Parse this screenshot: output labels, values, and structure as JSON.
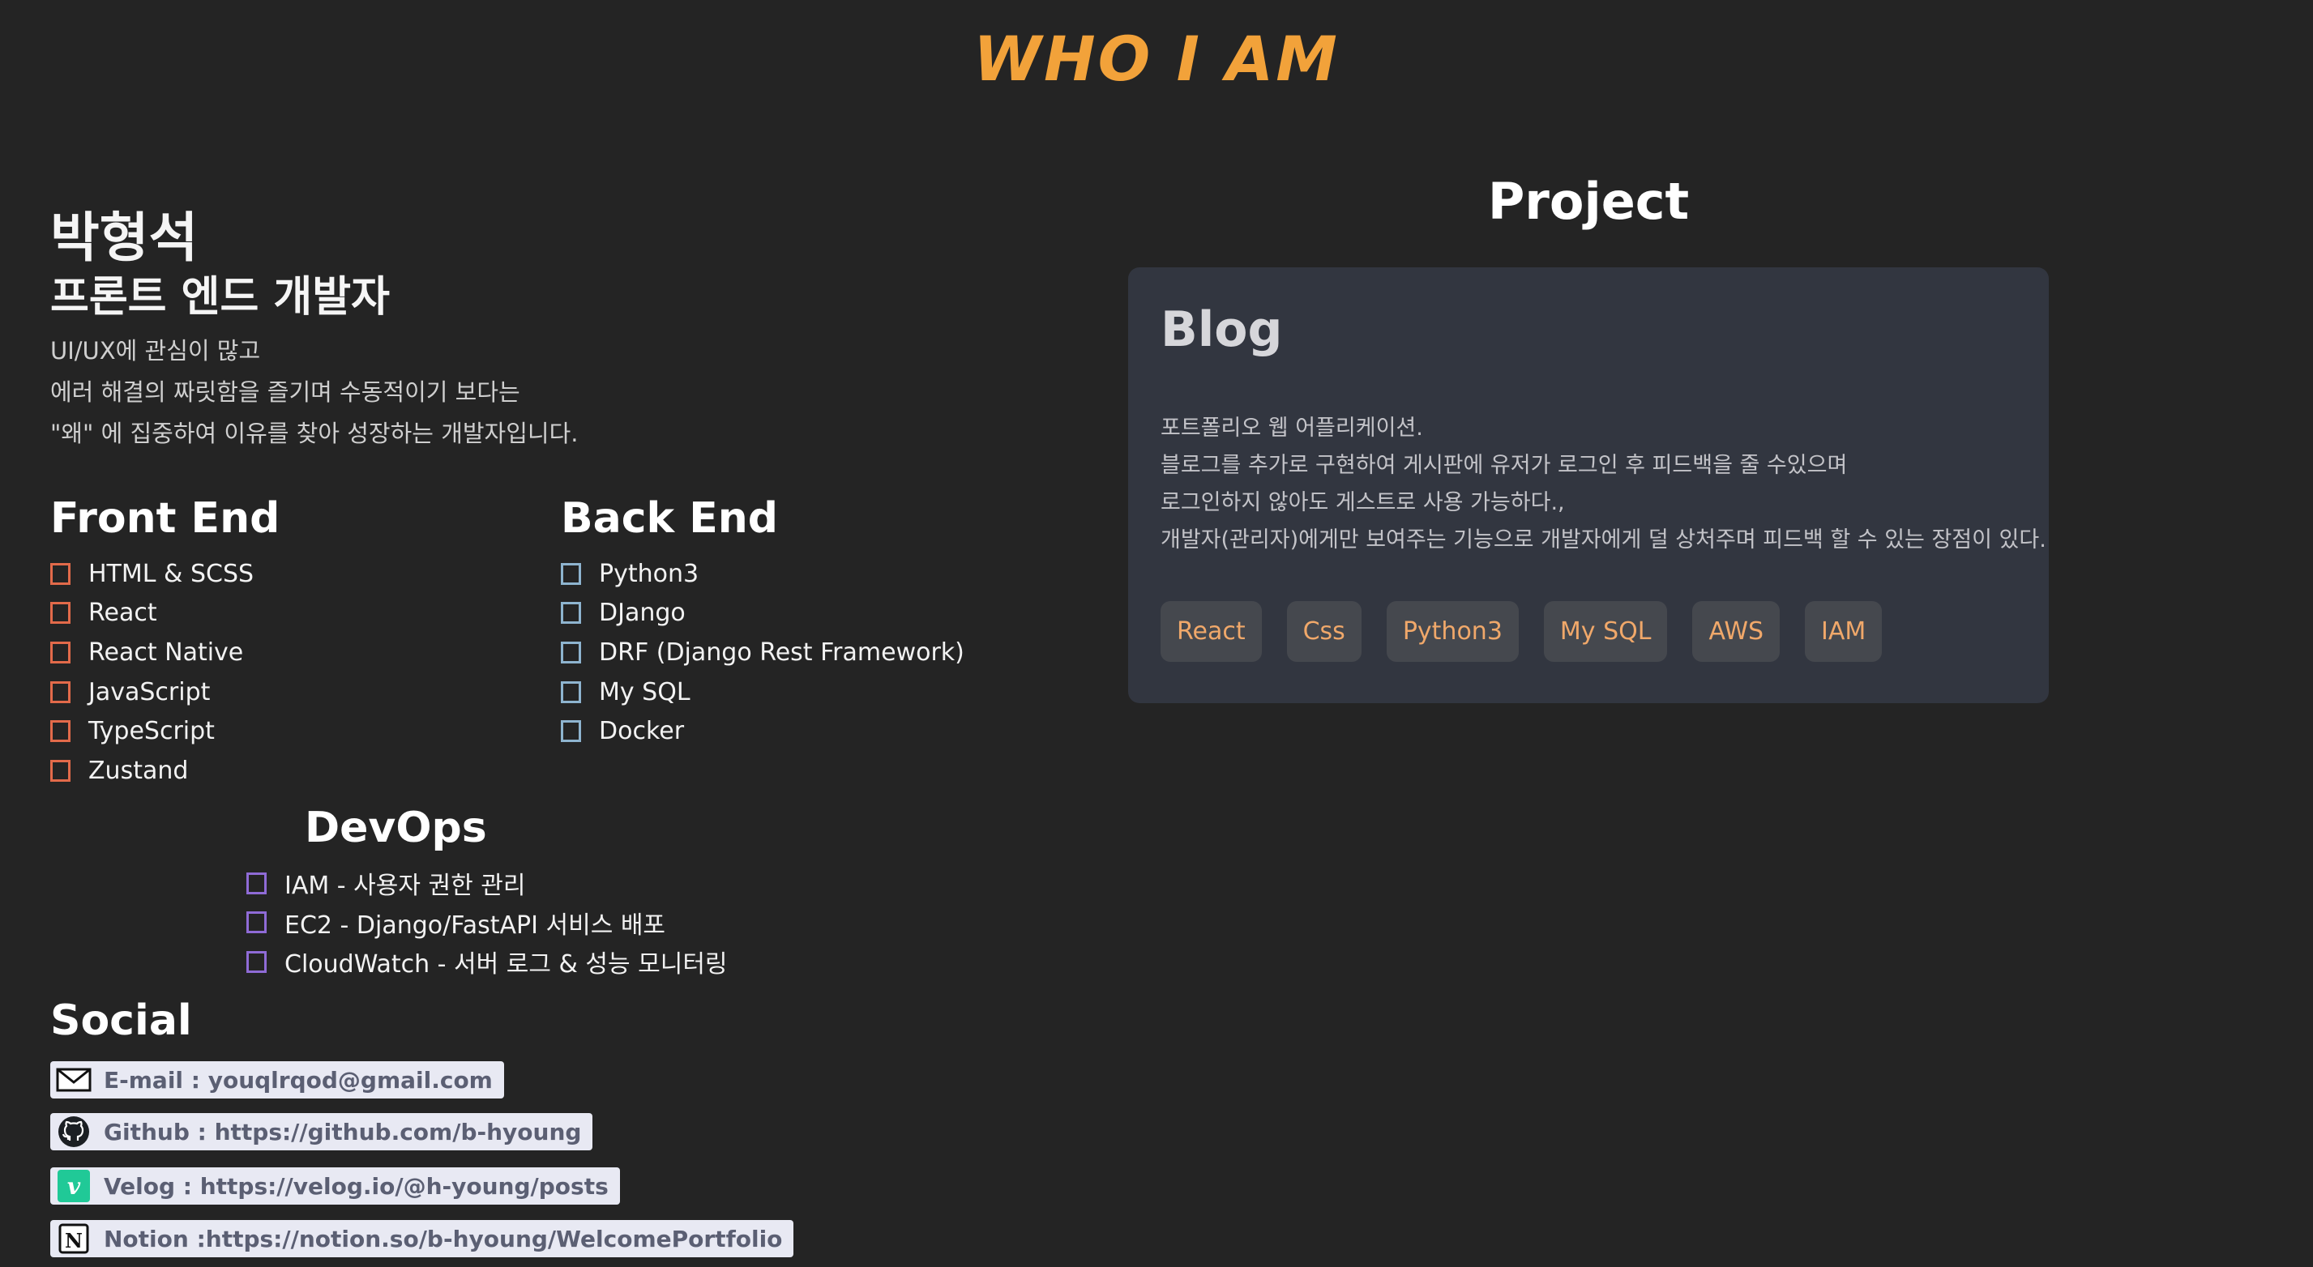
{
  "header": {
    "title": "WHO I AM"
  },
  "profile": {
    "name": "박형석",
    "role": "프론트 엔드 개발자",
    "intro": [
      "UI/UX에 관심이 많고",
      "에러 해결의 짜릿함을 즐기며 수동적이기 보다는",
      "\"왜\" 에 집중하여 이유를 찾아 성장하는 개발자입니다."
    ]
  },
  "skills": {
    "frontend": {
      "title": "Front End",
      "items": [
        "HTML & SCSS",
        "React",
        "React Native",
        "JavaScript",
        "TypeScript",
        "Zustand"
      ]
    },
    "backend": {
      "title": "Back End",
      "items": [
        "Python3",
        "DJango",
        "DRF (Django Rest Framework)",
        "My SQL",
        "Docker"
      ]
    },
    "devops": {
      "title": "DevOps",
      "items": [
        "IAM - 사용자 권한 관리",
        "EC2 - Django/FastAPI 서비스 배포",
        "CloudWatch - 서버 로그 & 성능 모니터링"
      ]
    }
  },
  "social": {
    "title": "Social",
    "links": [
      {
        "label": "E-mail : youqlrqod@gmail.com",
        "icon": "mail-icon"
      },
      {
        "label": "Github : https://github.com/b-hyoung",
        "icon": "github-icon"
      },
      {
        "label": "Velog : https://velog.io/@h-young/posts",
        "icon": "velog-icon"
      },
      {
        "label": "Notion :https://notion.so/b-hyoung/WelcomePortfolio",
        "icon": "notion-icon"
      }
    ]
  },
  "projects": {
    "title": "Project",
    "items": [
      {
        "title": "Blog",
        "description": [
          "포트폴리오 웹 어플리케이션.",
          "블로그를 추가로 구현하여 게시판에 유저가 로그인 후 피드백을 줄 수있으며",
          "로그인하지 않아도 게스트로 사용 가능하다.,",
          "개발자(관리자)에게만 보여주는 기능으로 개발자에게 덜 상처주며 피드백 할 수 있는 장점이 있다."
        ],
        "tags": [
          "React",
          "Css",
          "Python3",
          "My SQL",
          "AWS",
          "IAM"
        ]
      }
    ]
  },
  "colors": {
    "background": "#242424",
    "title_accent": "#f2a23a",
    "frontend_box": "#e26a4a",
    "backend_box": "#8eb4cf",
    "devops_box": "#8f6bd6",
    "tag_text": "#f0a86a",
    "card_bg": "#323640"
  }
}
